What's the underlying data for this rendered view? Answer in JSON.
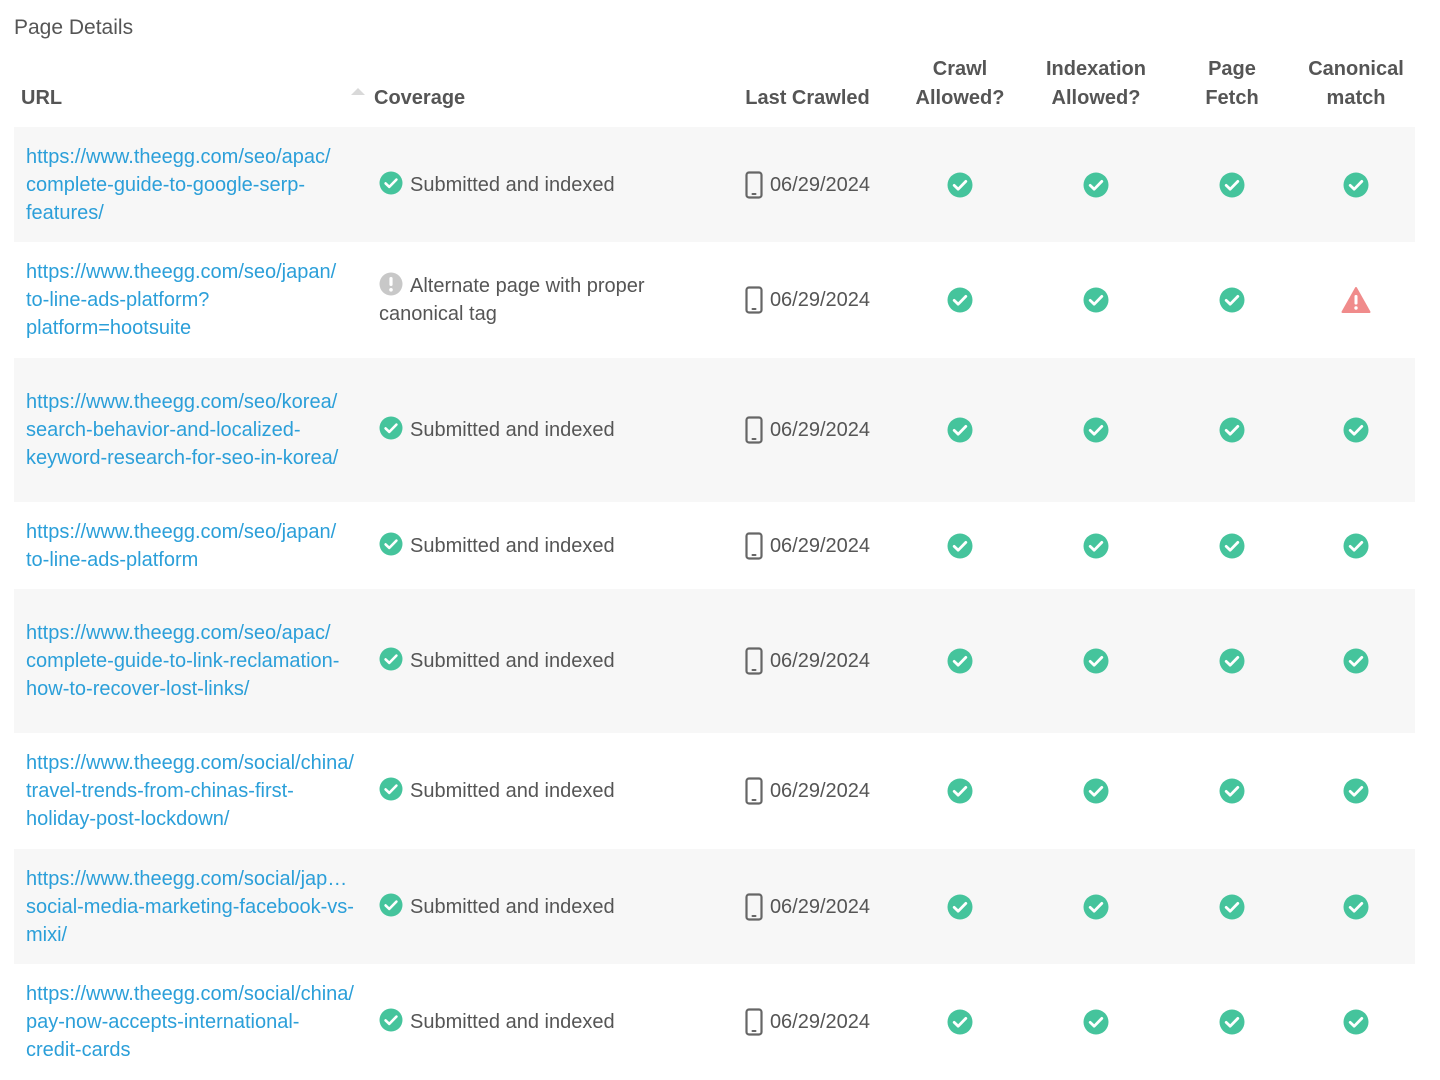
{
  "page": {
    "title": "Page Details"
  },
  "colors": {
    "link": "#2b9fd9",
    "ok": "#45c49c",
    "warning": "#f08b8b",
    "info": "#c8c8c8",
    "row_alt": "#f7f7f7"
  },
  "table": {
    "headers": {
      "url": "URL",
      "coverage": "Coverage",
      "last_crawled": "Last Crawled",
      "crawl_allowed_1": "Crawl",
      "crawl_allowed_2": "Allowed?",
      "indexation_allowed_1": "Indexation",
      "indexation_allowed_2": "Allowed?",
      "page_fetch_1": "Page",
      "page_fetch_2": "Fetch",
      "canonical_match_1": "Canonical",
      "canonical_match_2": "match"
    },
    "rows": [
      {
        "url_first": "https://www.theegg.com/seo/apac/",
        "url_rest": "complete-guide-to-google-serp-features/",
        "coverage": "Submitted and indexed",
        "coverage_status": "ok",
        "last_crawled": "06/29/2024",
        "crawl": "ok",
        "index": "ok",
        "fetch": "ok",
        "canonical": "ok"
      },
      {
        "url_first": "https://www.theegg.com/seo/japan/",
        "url_rest": "to-line-ads-platform?platform=hootsuite",
        "coverage": "Alternate page with proper canonical tag",
        "coverage_status": "info",
        "last_crawled": "06/29/2024",
        "crawl": "ok",
        "index": "ok",
        "fetch": "ok",
        "canonical": "warning"
      },
      {
        "url_first": "https://www.theegg.com/seo/korea/",
        "url_rest": "search-behavior-and-localized-keyword-research-for-seo-in-korea/",
        "coverage": "Submitted and indexed",
        "coverage_status": "ok",
        "last_crawled": "06/29/2024",
        "crawl": "ok",
        "index": "ok",
        "fetch": "ok",
        "canonical": "ok"
      },
      {
        "url_first": "https://www.theegg.com/seo/japan/",
        "url_rest": "to-line-ads-platform",
        "coverage": "Submitted and indexed",
        "coverage_status": "ok",
        "last_crawled": "06/29/2024",
        "crawl": "ok",
        "index": "ok",
        "fetch": "ok",
        "canonical": "ok"
      },
      {
        "url_first": "https://www.theegg.com/seo/apac/",
        "url_rest": "complete-guide-to-link-reclamation-how-to-recover-lost-links/",
        "coverage": "Submitted and indexed",
        "coverage_status": "ok",
        "last_crawled": "06/29/2024",
        "crawl": "ok",
        "index": "ok",
        "fetch": "ok",
        "canonical": "ok"
      },
      {
        "url_first": "https://www.theegg.com/social/china/",
        "url_rest": "travel-trends-from-chinas-first-holiday-post-lockdown/",
        "coverage": "Submitted and indexed",
        "coverage_status": "ok",
        "last_crawled": "06/29/2024",
        "crawl": "ok",
        "index": "ok",
        "fetch": "ok",
        "canonical": "ok"
      },
      {
        "url_first": "https://www.theegg.com/social/japan/",
        "url_rest": "social-media-marketing-facebook-vs-mixi/",
        "coverage": "Submitted and indexed",
        "coverage_status": "ok",
        "last_crawled": "06/29/2024",
        "crawl": "ok",
        "index": "ok",
        "fetch": "ok",
        "canonical": "ok"
      },
      {
        "url_first": "https://www.theegg.com/social/china/",
        "url_rest": "pay-now-accepts-international-credit-cards",
        "coverage": "Submitted and indexed",
        "coverage_status": "ok",
        "last_crawled": "06/29/2024",
        "crawl": "ok",
        "index": "ok",
        "fetch": "ok",
        "canonical": "ok"
      }
    ]
  }
}
